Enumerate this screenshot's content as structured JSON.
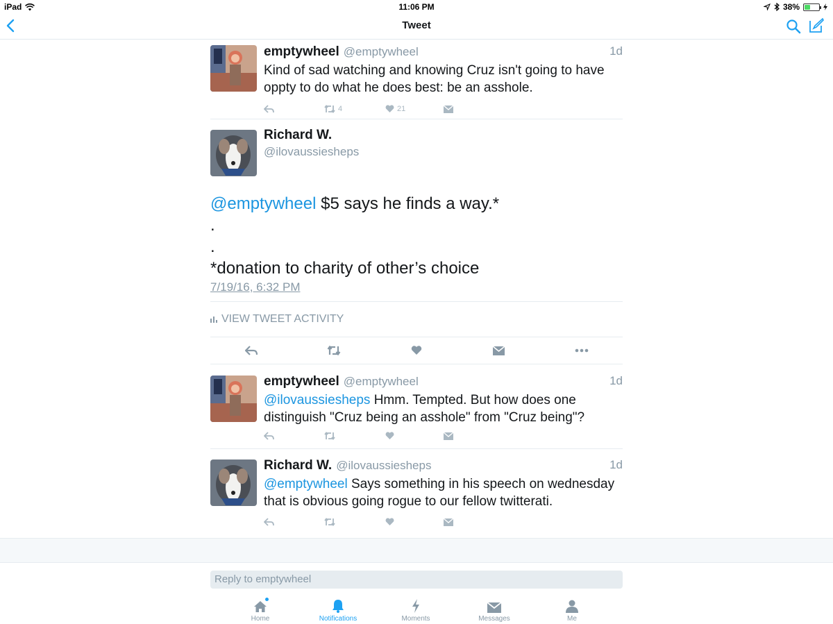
{
  "status_bar": {
    "device": "iPad",
    "time": "11:06 PM",
    "battery": "38%",
    "battery_level": 0.38
  },
  "nav": {
    "title": "Tweet",
    "back_icon": "chevron-left-icon",
    "search_icon": "search-icon",
    "compose_icon": "compose-icon"
  },
  "context_tweet": {
    "name": "emptywheel",
    "handle": "@emptywheel",
    "time": "1d",
    "text": "Kind of sad watching and knowing Cruz isn't going to have oppty to do what he does best: be an asshole.",
    "retweets": "4",
    "likes": "21"
  },
  "main_tweet": {
    "name": "Richard W.",
    "handle": "@ilovaussiesheps",
    "mention": "@emptywheel",
    "text_line1": " $5 says he finds a way.*",
    "dot1": ".",
    "dot2": ".",
    "text_line4": "*donation to charity of other’s choice",
    "date": "7/19/16, 6:32 PM",
    "activity_label": "VIEW TWEET ACTIVITY"
  },
  "replies": [
    {
      "name": "emptywheel",
      "handle": "@emptywheel",
      "time": "1d",
      "mention": "@ilovaussiesheps",
      "text": " Hmm. Tempted. But how does one distinguish \"Cruz being an asshole\" from \"Cruz being\"?"
    },
    {
      "name": "Richard W.",
      "handle": "@ilovaussiesheps",
      "time": "1d",
      "mention": "@emptywheel",
      "text": " Says something in his speech on wednesday that is obvious going rogue to our fellow twitterati."
    }
  ],
  "reply_box": {
    "placeholder": "Reply to emptywheel"
  },
  "tabs": [
    {
      "label": "Home",
      "icon": "home-icon"
    },
    {
      "label": "Notifications",
      "icon": "bell-icon"
    },
    {
      "label": "Moments",
      "icon": "lightning-icon"
    },
    {
      "label": "Messages",
      "icon": "envelope-icon"
    },
    {
      "label": "Me",
      "icon": "person-icon"
    }
  ],
  "colors": {
    "accent": "#1da1f2",
    "link": "#1b95e0",
    "muted": "#8899a6"
  }
}
